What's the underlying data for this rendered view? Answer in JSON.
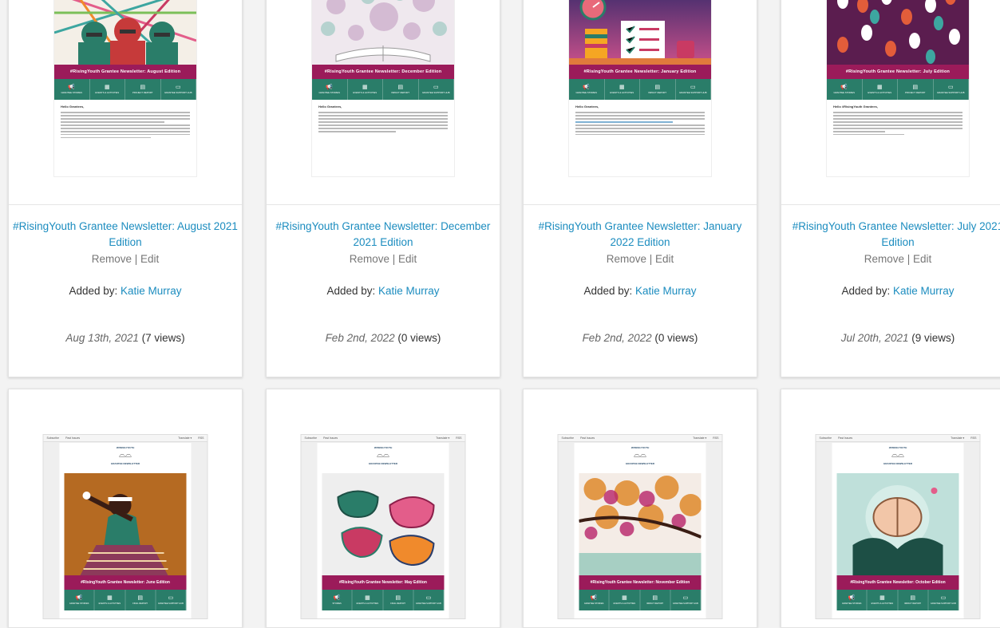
{
  "cards": [
    {
      "title": "#RisingYouth Grantee Newsletter: August 2021 Edition",
      "remove": "Remove",
      "edit": "Edit",
      "added_by_label": "Added by:",
      "added_by_user": "Katie Murray",
      "date": "Aug 13th, 2021",
      "views": "(7 views)",
      "banner": "#RisingYouth Grantee Newsletter: August Edition",
      "greeting": "Hello Grantees,",
      "icons": [
        "GRANTEE STORIES",
        "EVENTS & ACTIVITIES",
        "PROJECT REPORT",
        "GRANTEE SUPPORT HUB"
      ]
    },
    {
      "title": "#RisingYouth Grantee Newsletter: December 2021 Edition",
      "remove": "Remove",
      "edit": "Edit",
      "added_by_label": "Added by:",
      "added_by_user": "Katie Murray",
      "date": "Feb 2nd, 2022",
      "views": "(0 views)",
      "banner": "#RisingYouth Grantee Newsletter: December Edition",
      "greeting": "Hello Grantees,",
      "icons": [
        "GRANTEE STORIES",
        "EVENTS & ACTIVITIES",
        "IMPACT REPORT",
        "GRANTEE SUPPORT HUB"
      ]
    },
    {
      "title": "#RisingYouth Grantee Newsletter: January 2022 Edition",
      "remove": "Remove",
      "edit": "Edit",
      "added_by_label": "Added by:",
      "added_by_user": "Katie Murray",
      "date": "Feb 2nd, 2022",
      "views": "(0 views)",
      "banner": "#RisingYouth Grantee Newsletter: January Edition",
      "greeting": "Hello Grantees,",
      "icons": [
        "GRANTEE STORIES",
        "EVENTS & ACTIVITIES",
        "IMPACT REPORT",
        "GRANTEE SUPPORT HUB"
      ]
    },
    {
      "title": "#RisingYouth Grantee Newsletter: July 2021 Edition",
      "remove": "Remove",
      "edit": "Edit",
      "added_by_label": "Added by:",
      "added_by_user": "Katie Murray",
      "date": "Jul 20th, 2021",
      "views": "(9 views)",
      "banner": "#RisingYouth Grantee Newsletter: July Edition",
      "greeting": "Hello #RisingYouth Grantees,",
      "icons": [
        "GRANTEE STORIES",
        "EVENTS & ACTIVITIES",
        "PROJECT REPORT",
        "GRANTEE SUPPORT HUB"
      ]
    }
  ],
  "bottom_cards": [
    {
      "banner": "#RisingYouth Grantee Newsletter: June Edition",
      "icons": [
        "GRANTEE STORIES",
        "EVENTS & ACTIVITIES",
        "FINAL REPORT",
        "GRANTEE SUPPORT HUB"
      ]
    },
    {
      "banner": "#RisingYouth Grantee Newsletter: May Edition",
      "icons": [
        "STORIES",
        "EVENTS & ACTIVITIES",
        "FINAL REPORT",
        "GRANTEE SUPPORT HUB"
      ]
    },
    {
      "banner": "#RisingYouth Grantee Newsletter: November Edition",
      "icons": [
        "GRANTEE STORIES",
        "EVENTS & ACTIVITIES",
        "IMPACT REPORT",
        "GRANTEE SUPPORT HUB"
      ]
    },
    {
      "banner": "#RisingYouth Grantee Newsletter: October Edition",
      "icons": [
        "GRANTEE STORIES",
        "EVENTS & ACTIVITIES",
        "IMPACT REPORT",
        "GRANTEE SUPPORT HUB"
      ]
    }
  ],
  "email_chrome": {
    "subscribe": "Subscribe",
    "past_issues": "Past Issues",
    "translate": "Translate ▾",
    "rss": "RSS",
    "logo_top": "#RISINGYOUTH",
    "logo_bottom": "GRANTEE NEWSLETTER"
  },
  "colors": {
    "link": "#1b8cbf",
    "banner": "#9b1b5a",
    "iconbar": "#2a7d69"
  }
}
